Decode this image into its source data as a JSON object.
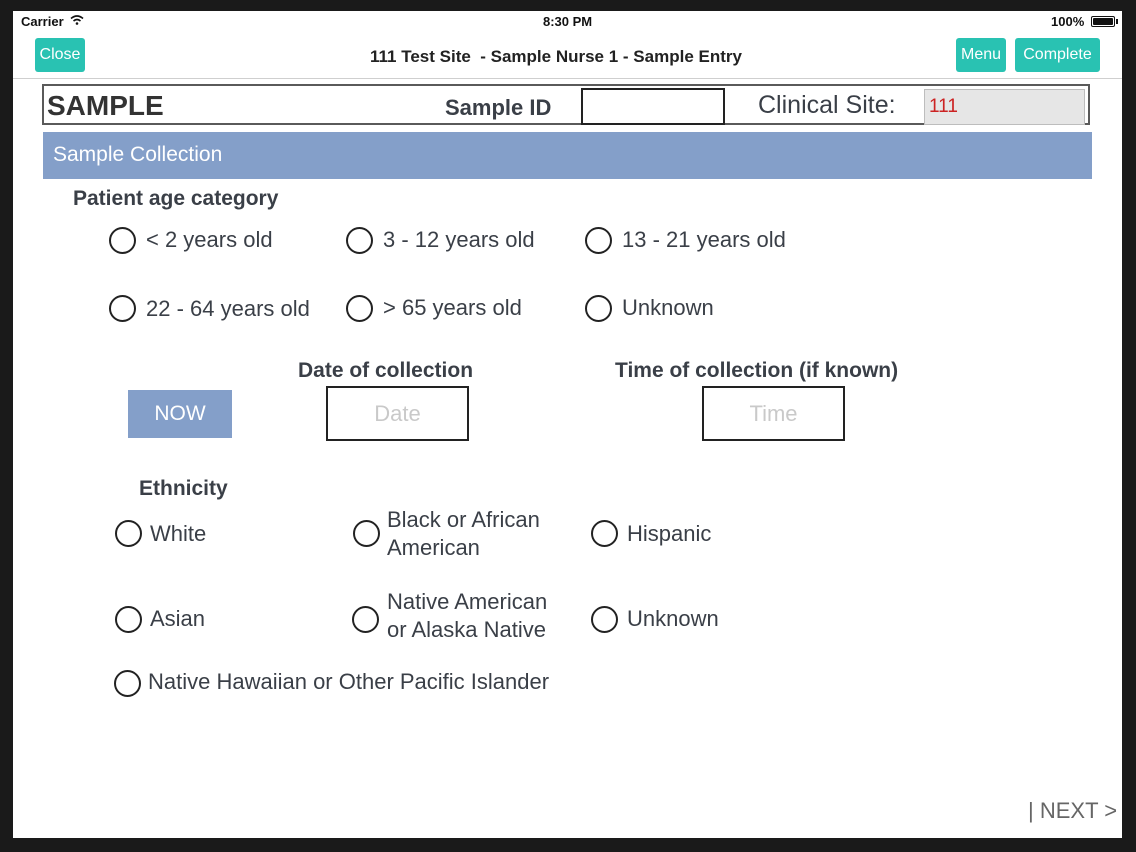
{
  "status_bar": {
    "carrier": "Carrier",
    "time": "8:30 PM",
    "battery": "100%"
  },
  "nav": {
    "close_label": "Close",
    "title": "111 Test Site  - Sample Nurse 1 - Sample Entry",
    "menu_label": "Menu",
    "complete_label": "Complete"
  },
  "header": {
    "sample_title": "SAMPLE",
    "sample_id_label": "Sample ID",
    "sample_id_value": "",
    "clinical_site_label": "Clinical Site:",
    "clinical_site_value": "111"
  },
  "section": {
    "title": "Sample Collection"
  },
  "age": {
    "label": "Patient age category",
    "options": [
      "< 2 years old",
      "3 - 12 years old",
      "13 - 21 years old",
      "22 - 64 years old",
      "> 65 years old",
      "Unknown"
    ]
  },
  "collection": {
    "now_label": "NOW",
    "date_label": "Date of collection",
    "date_placeholder": "Date",
    "time_label": "Time of collection (if known)",
    "time_placeholder": "Time"
  },
  "ethnicity": {
    "label": "Ethnicity",
    "options": [
      {
        "line1": "White",
        "line2": ""
      },
      {
        "line1": "Black or African",
        "line2": "American"
      },
      {
        "line1": "Hispanic",
        "line2": ""
      },
      {
        "line1": "Asian",
        "line2": ""
      },
      {
        "line1": "Native American",
        "line2": "or Alaska Native"
      },
      {
        "line1": "Unknown",
        "line2": ""
      },
      {
        "line1": "Native Hawaiian or Other Pacific Islander",
        "line2": ""
      }
    ]
  },
  "footer": {
    "next_label": "| NEXT >"
  },
  "colors": {
    "accent": "#29c2b2",
    "section": "#849fc9",
    "clinical_value": "#cc2222"
  }
}
